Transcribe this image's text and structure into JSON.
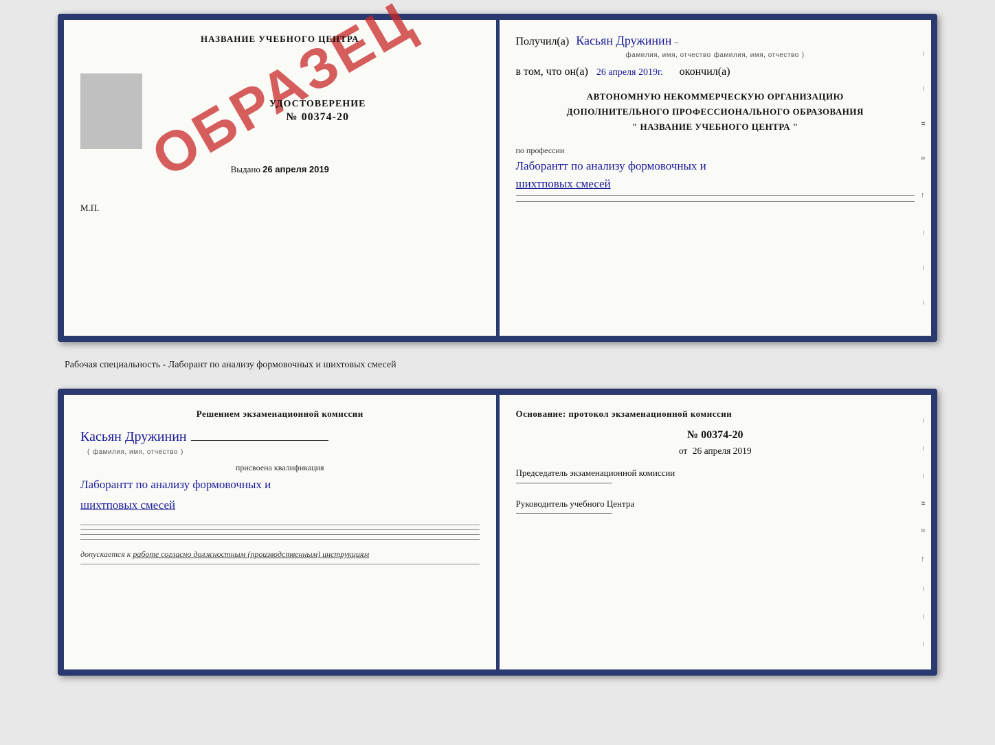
{
  "cert": {
    "left": {
      "title": "НАЗВАНИЕ УЧЕБНОГО ЦЕНТРА",
      "stamp_text": "ОБРАЗЕЦ",
      "doc_label": "УДОСТОВЕРЕНИЕ",
      "doc_number": "№ 00374-20",
      "issued_label": "Выдано",
      "issued_date": "26 апреля 2019",
      "mp_label": "М.П."
    },
    "right": {
      "received_label": "Получил(а)",
      "received_fio": "Касьян Дружинин",
      "fio_sub": "фамилия, имя, отчество",
      "date_label": "в том, что он(а)",
      "date_value": "26 апреля 2019г.",
      "date_finished": "окончил(а)",
      "org_line1": "АВТОНОМНУЮ НЕКОММЕРЧЕСКУЮ ОРГАНИЗАЦИЮ",
      "org_line2": "ДОПОЛНИТЕЛЬНОГО ПРОФЕССИОНАЛЬНОГО ОБРАЗОВАНИЯ",
      "org_line3": "\"   НАЗВАНИЕ УЧЕБНОГО ЦЕНТРА   \"",
      "profession_label": "по профессии",
      "profession_text": "Лаборантт по анализу формовочных и шихтповых смесей",
      "side_markers": [
        "–",
        "–",
        "и",
        "а",
        "←",
        "–",
        "–",
        "–"
      ]
    }
  },
  "specialty_line": "Рабочая специальность - Лаборант по анализу формовочных и шихтовых смесей",
  "commission": {
    "left": {
      "title": "Решением экзаменационной комиссии",
      "fio": "Касьян Дружинин",
      "fio_sub": "фамилия, имя, отчество",
      "qual_label": "присвоена квалификация",
      "qual_text": "Лаборантт по анализу формовочных и шихтповых смесей",
      "допуск_label": "допускается к",
      "допуск_text": "работе согласно должностным (производственным) инструкциям"
    },
    "right": {
      "title": "Основание: протокол экзаменационной комиссии",
      "protocol_number": "№ 00374-20",
      "protocol_date_prefix": "от",
      "protocol_date": "26 апреля 2019",
      "chairman_label": "Председатель экзаменационной комиссии",
      "director_label": "Руководитель учебного Центра",
      "side_markers": [
        "–",
        "–",
        "–",
        "и",
        "а",
        "←",
        "–",
        "–",
        "–"
      ]
    }
  }
}
